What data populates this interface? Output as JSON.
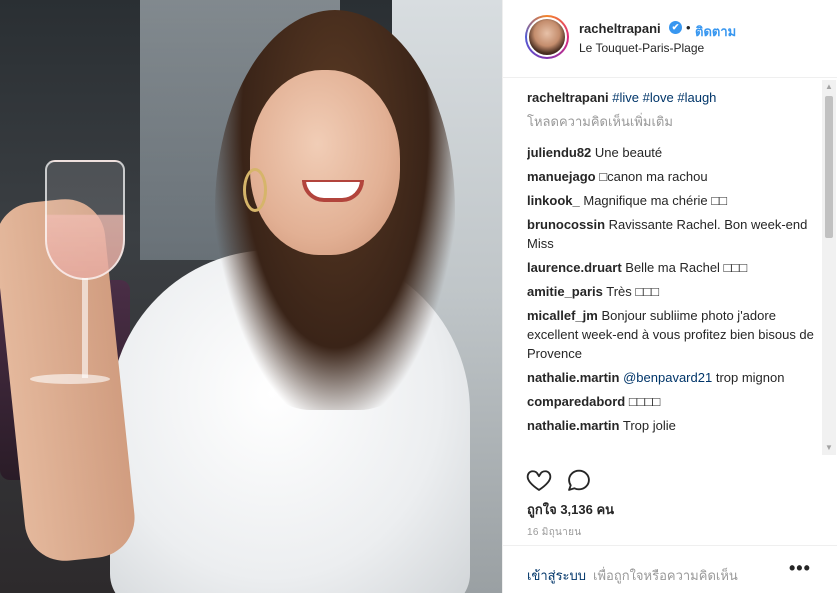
{
  "header": {
    "username": "racheltrapani",
    "verified_glyph": "✔",
    "separator": "•",
    "follow_label": "ติดตาม",
    "location": "Le Touquet-Paris-Plage"
  },
  "caption": {
    "user": "racheltrapani",
    "tags": [
      "#live",
      "#love",
      "#laugh"
    ]
  },
  "load_more": "โหลดความคิดเห็นเพิ่มเติม",
  "comments": [
    {
      "user": "juliendu82",
      "text": "Une beauté"
    },
    {
      "user": "manuejago",
      "text": "□canon ma rachou"
    },
    {
      "user": "linkook_",
      "text": "Magnifique ma chérie □□"
    },
    {
      "user": "brunocossin",
      "text": "Ravissante Rachel. Bon week-end Miss"
    },
    {
      "user": "laurence.druart",
      "text": "Belle ma Rachel □□□"
    },
    {
      "user": "amitie_paris",
      "text": "Très □□□"
    },
    {
      "user": "micallef_jm",
      "text": "Bonjour subliime photo j'adore excellent week-end à vous profitez bien bisous de Provence"
    },
    {
      "user": "nathalie.martin",
      "mention": "@benpavard21",
      "text": "trop mignon"
    },
    {
      "user": "comparedabord",
      "text": "□□□□"
    },
    {
      "user": "nathalie.martin",
      "text": "Trop jolie"
    }
  ],
  "actions": {
    "like_icon": "heart-icon",
    "comment_icon": "comment-bubble-icon"
  },
  "likes": "ถูกใจ 3,136 คน",
  "timestamp": "16 มิถุนายน",
  "footer": {
    "login": "เข้าสู่ระบบ",
    "login_rest": "เพื่อถูกใจหรือความคิดเห็น",
    "more": "•••"
  },
  "colors": {
    "link_blue": "#3897f0",
    "tag_blue": "#003569",
    "muted": "#999999"
  }
}
